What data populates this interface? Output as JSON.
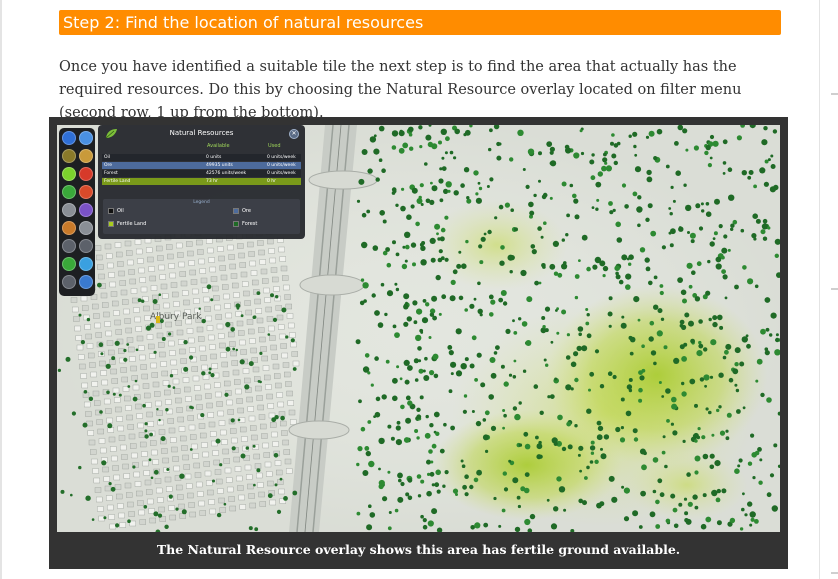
{
  "step": {
    "title": "Step 2: Find the location of natural resources",
    "color": "#ff8c00"
  },
  "intro": {
    "text": "Once you have identified a suitable tile the next step is to find the area that actually has the required resources. Do this by choosing the Natural Resource overlay located on filter menu (second row, 1 up from the bottom)."
  },
  "figure": {
    "caption": "The Natural Resource overlay shows this area has fertile ground available.",
    "map_label": "Albury Park"
  },
  "filter_menu": {
    "buttons": [
      {
        "name": "water-icon",
        "color": "#2f6fd6"
      },
      {
        "name": "electricity-icon",
        "color": "#4a90e2"
      },
      {
        "name": "garbage-icon",
        "color": "#8a7a2a"
      },
      {
        "name": "education-icon",
        "color": "#c99a3a"
      },
      {
        "name": "happiness-icon",
        "color": "#7cd12d"
      },
      {
        "name": "health-icon",
        "color": "#d63a2a"
      },
      {
        "name": "land-value-icon",
        "color": "#3aa83a"
      },
      {
        "name": "fire-icon",
        "color": "#d94a2a"
      },
      {
        "name": "crime-icon",
        "color": "#8a8f96"
      },
      {
        "name": "natural-resources-icon",
        "color": "#7a52c7"
      },
      {
        "name": "noise-icon",
        "color": "#c97a2a"
      },
      {
        "name": "pollution-icon",
        "color": "#8a8f96"
      },
      {
        "name": "death-care-icon",
        "color": "#5c616a"
      },
      {
        "name": "public-transport-icon",
        "color": "#5c616a"
      },
      {
        "name": "money-icon",
        "color": "#3aa83a"
      },
      {
        "name": "wind-icon",
        "color": "#3aa0e0"
      },
      {
        "name": "traffic-icon",
        "color": "#5c616a"
      },
      {
        "name": "clock-icon",
        "color": "#3a7ad0"
      }
    ]
  },
  "natural_resources": {
    "title": "Natural Resources",
    "close_label": "✕",
    "col_available": "Available",
    "col_used": "Used",
    "rows": [
      {
        "name": "Oil",
        "available": "0 units",
        "used": "0 units/week",
        "color": "#23262c"
      },
      {
        "name": "Ore",
        "available": "49935 units",
        "used": "0 units/week",
        "color": "#4d6b9c"
      },
      {
        "name": "Forest",
        "available": "42576 units/week",
        "used": "0 units/week",
        "color": "#23262c"
      },
      {
        "name": "Fertile Land",
        "available": "73 hr",
        "used": "0 hr",
        "color": "#7a9a1a"
      }
    ],
    "legend": {
      "title": "Legend",
      "oil": "Oil",
      "ore": "Ore",
      "fertile": "Fertile Land",
      "forest": "Forest"
    }
  },
  "colors": {
    "fertile": "#a8cc1e",
    "forest": "#1f6a26",
    "ore": "#4d6b9c",
    "oil": "#111111"
  }
}
